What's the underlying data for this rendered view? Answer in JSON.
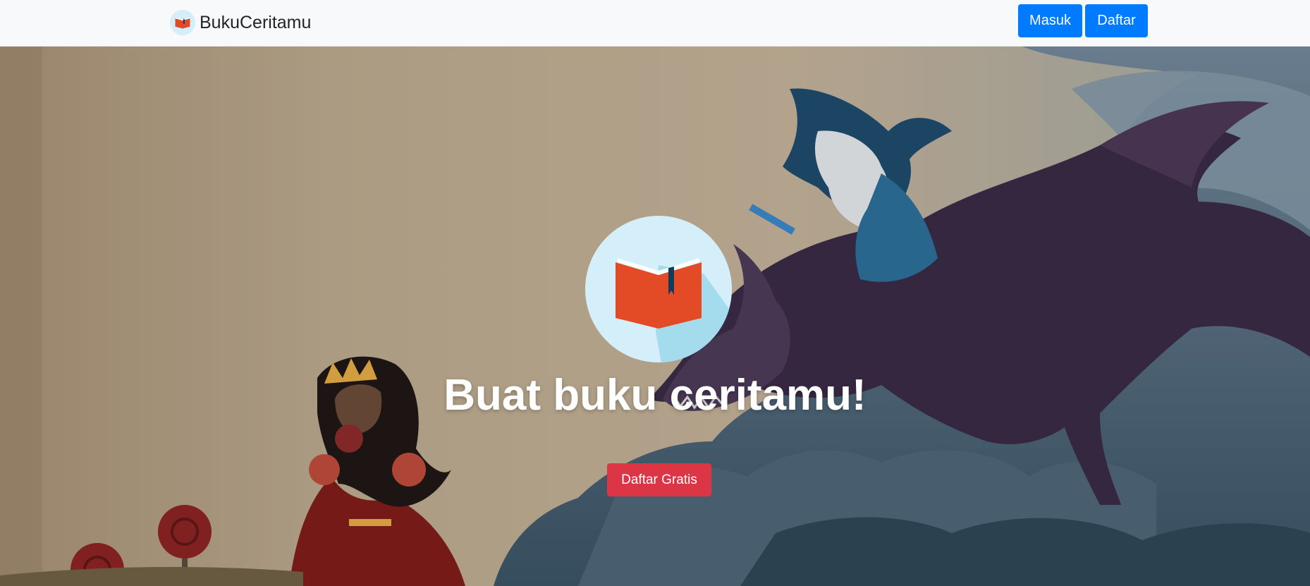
{
  "navbar": {
    "brand_name": "BukuCeritamu",
    "login_label": "Masuk",
    "register_label": "Daftar"
  },
  "hero": {
    "title": "Buat buku ceritamu!",
    "cta_label": "Daftar Gratis"
  },
  "colors": {
    "primary_button": "#007bff",
    "cta_button": "#dc3545",
    "navbar_bg": "#f8f9fa",
    "logo_circle": "#d4effa",
    "book_red": "#e34b27",
    "bookmark_navy": "#0f3c5a"
  },
  "icons": {
    "brand_logo": "book-logo-icon",
    "hero_logo": "book-logo-icon"
  }
}
